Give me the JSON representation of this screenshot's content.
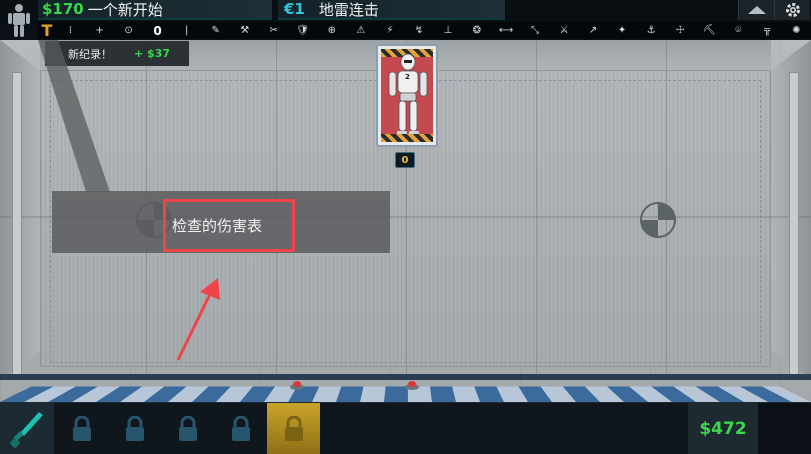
{
  "header": {
    "challenge_money": "$170",
    "challenge_title": "一个新开始",
    "mission_credits": "€1",
    "mission_title": "地雷连击"
  },
  "toolbar": {
    "items": [
      "⁞",
      "+",
      "⊙",
      "0",
      "|",
      "✎",
      "⚒",
      "✂",
      "🛡",
      "⊕",
      "⚠",
      "⚡",
      "↯",
      "⊥",
      "❂",
      "⟷",
      "⤡",
      "⚔",
      "↗",
      "✦",
      "⚓",
      "☩",
      "⛏",
      "⌾",
      "╦",
      "✺"
    ]
  },
  "record": {
    "label": "新纪录！",
    "amount": "+ $37"
  },
  "robot": {
    "number": "2",
    "badge": "0"
  },
  "tooltip": {
    "text": "检查的伤害表"
  },
  "bottombar": {
    "cash": "$472",
    "lock_count": 5
  },
  "colors": {
    "money_green": "#38d64a",
    "credit_cyan": "#33c6d9",
    "highlight_red": "#f0444a",
    "active_slot_gold": "#c9a42a"
  }
}
